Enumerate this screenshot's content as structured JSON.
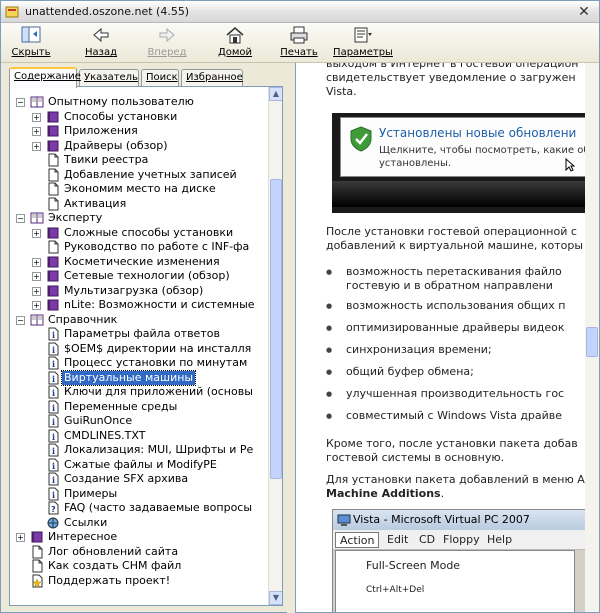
{
  "window": {
    "title": "unattended.oszone.net (4.55)",
    "close_glyph": "✕"
  },
  "toolbar": {
    "hide_label": "Скрыть",
    "back_label": "Назад",
    "forward_label": "Вперед",
    "home_label": "Домой",
    "print_label": "Печать",
    "options_label": "Параметры"
  },
  "tabs": [
    {
      "label": "Содержание"
    },
    {
      "label": "Указатель"
    },
    {
      "label": "Поиск"
    },
    {
      "label": "Избранное"
    }
  ],
  "tree": [
    {
      "label": "Опытному пользователю",
      "level": 0,
      "icon": "book-open-icon",
      "expander": "−"
    },
    {
      "label": "Способы установки",
      "level": 1,
      "icon": "book-closed-icon",
      "expander": "+"
    },
    {
      "label": "Приложения",
      "level": 1,
      "icon": "book-closed-icon",
      "expander": "+"
    },
    {
      "label": "Драйверы (обзор)",
      "level": 1,
      "icon": "book-closed-icon",
      "expander": "+"
    },
    {
      "label": "Твики реестра",
      "level": 1,
      "icon": "page-icon",
      "expander": ""
    },
    {
      "label": "Добавление учетных записей",
      "level": 1,
      "icon": "page-icon",
      "expander": ""
    },
    {
      "label": "Экономим место на диске",
      "level": 1,
      "icon": "page-icon",
      "expander": ""
    },
    {
      "label": "Активация",
      "level": 1,
      "icon": "page-icon",
      "expander": ""
    },
    {
      "label": "Эксперту",
      "level": 0,
      "icon": "book-open-icon",
      "expander": "−"
    },
    {
      "label": "Сложные способы установки",
      "level": 1,
      "icon": "book-closed-icon",
      "expander": "+"
    },
    {
      "label": "Руководство по работе с INF-фа",
      "level": 1,
      "icon": "page-icon",
      "expander": ""
    },
    {
      "label": "Косметические изменения",
      "level": 1,
      "icon": "book-closed-icon",
      "expander": "+"
    },
    {
      "label": "Сетевые технологии (обзор)",
      "level": 1,
      "icon": "book-closed-icon",
      "expander": "+"
    },
    {
      "label": "Мультизагрузка (обзор)",
      "level": 1,
      "icon": "book-closed-icon",
      "expander": "+"
    },
    {
      "label": "nLite: Возможности и системные",
      "level": 1,
      "icon": "book-closed-icon",
      "expander": "+"
    },
    {
      "label": "Справочник",
      "level": 0,
      "icon": "book-open-icon",
      "expander": "−"
    },
    {
      "label": "Параметры файла ответов",
      "level": 1,
      "icon": "info-page-icon",
      "expander": ""
    },
    {
      "label": "$OEM$ директории на инсталля",
      "level": 1,
      "icon": "info-page-icon",
      "expander": ""
    },
    {
      "label": "Процесс установки по минутам",
      "level": 1,
      "icon": "info-page-icon",
      "expander": ""
    },
    {
      "label": "Виртуальные машины",
      "level": 1,
      "icon": "info-page-icon",
      "expander": "",
      "selected": true
    },
    {
      "label": "Ключи для приложений (основы",
      "level": 1,
      "icon": "info-page-icon",
      "expander": ""
    },
    {
      "label": "Переменные среды",
      "level": 1,
      "icon": "info-page-icon",
      "expander": ""
    },
    {
      "label": "GuiRunOnce",
      "level": 1,
      "icon": "info-page-icon",
      "expander": ""
    },
    {
      "label": "CMDLINES.TXT",
      "level": 1,
      "icon": "info-page-icon",
      "expander": ""
    },
    {
      "label": "Локализация: MUI, Шрифты и Ре",
      "level": 1,
      "icon": "info-page-icon",
      "expander": ""
    },
    {
      "label": "Сжатые файлы и ModifyPE",
      "level": 1,
      "icon": "info-page-icon",
      "expander": ""
    },
    {
      "label": "Создание SFX архива",
      "level": 1,
      "icon": "info-page-icon",
      "expander": ""
    },
    {
      "label": "Примеры",
      "level": 1,
      "icon": "info-page-icon",
      "expander": ""
    },
    {
      "label": "FAQ (часто задаваемые вопросы",
      "level": 1,
      "icon": "help-page-icon",
      "expander": ""
    },
    {
      "label": "Ссылки",
      "level": 1,
      "icon": "globe-page-icon",
      "expander": ""
    },
    {
      "label": "Интересное",
      "level": 0,
      "icon": "book-closed-icon",
      "expander": "+"
    },
    {
      "label": "Лог обновлений сайта",
      "level": 0,
      "icon": "page-icon",
      "expander": ""
    },
    {
      "label": "Как создать CHM файл",
      "level": 0,
      "icon": "page-icon",
      "expander": ""
    },
    {
      "label": "Поддержать проект!",
      "level": 0,
      "icon": "star-page-icon",
      "expander": ""
    }
  ],
  "content": {
    "intro_line1": "выходом в Интернет в гостевой операцион",
    "intro_line2": "свидетельствует уведомление о загружен",
    "intro_line3": "Vista.",
    "popup_title": "Установлены новые обновлени",
    "popup_text1": "Щелкните, чтобы посмотреть, какие обн",
    "popup_text2": "установлены.",
    "para2_line1": "После установки гостевой операционной с",
    "para2_line2": "добавлений к виртуальной машине, которы",
    "bullets": [
      {
        "line1": "возможность перетаскивания файло",
        "line2": "гостевую и в обратном направлени"
      },
      {
        "line1": "возможность использования общих п",
        "line2": ""
      },
      {
        "line1": "оптимизированные драйверы видеок",
        "line2": ""
      },
      {
        "line1": "синхронизация времени;",
        "line2": ""
      },
      {
        "line1": "общий буфер обмена;",
        "line2": ""
      },
      {
        "line1": "улучшенная производительность гос",
        "line2": ""
      },
      {
        "line1": "совместимый с Windows Vista драйве",
        "line2": ""
      }
    ],
    "para3_line1": "Кроме того, после установки пакета добав",
    "para3_line2": "гостевой системы в основную.",
    "para4_line1": "Для установки пакета добавлений в меню А",
    "para4_bold": "Machine Additions",
    "para4_end": ".",
    "vpc_title": "Vista - Microsoft Virtual PC 2007",
    "vpc_menu": [
      "Action",
      "Edit",
      "CD",
      "Floppy",
      "Help"
    ],
    "vpc_items": [
      "Full-Screen Mode",
      "Ctrl+Alt+Del"
    ]
  },
  "colors": {
    "selection": "#316ac5",
    "link_blue": "#1e5fa8"
  }
}
